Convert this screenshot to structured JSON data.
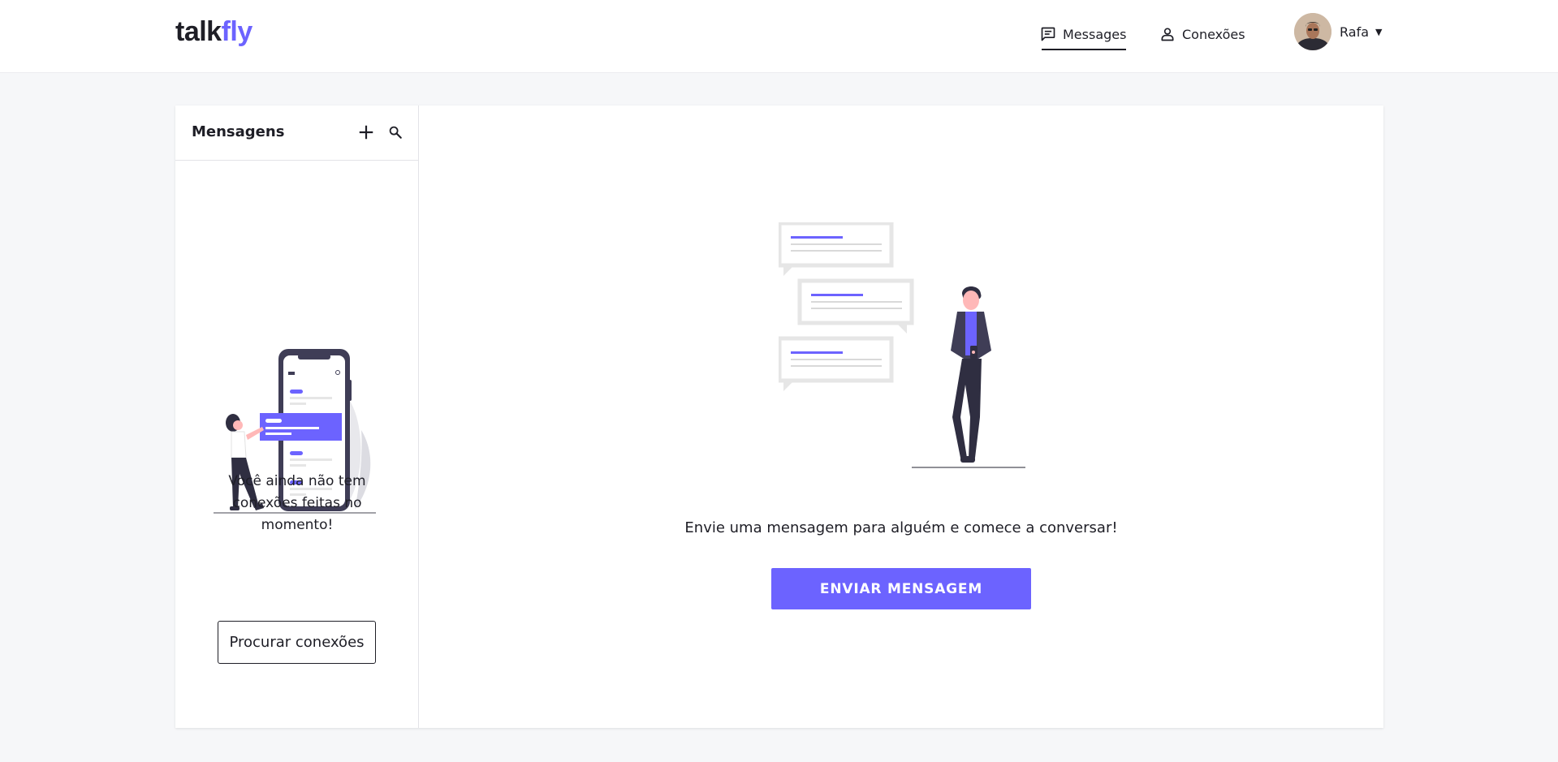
{
  "brand": {
    "name_part1": "talk",
    "name_part2": "fly",
    "accent_color": "#6c63ff"
  },
  "nav": {
    "items": [
      {
        "label": "Messages",
        "icon": "message-icon",
        "active": true
      },
      {
        "label": "Conexões",
        "icon": "person-icon",
        "active": false
      }
    ]
  },
  "user": {
    "name": "Rafa",
    "menu_icon": "caret-down-icon"
  },
  "sidebar": {
    "title": "Mensagens",
    "add_icon": "plus-icon",
    "search_icon": "search-icon",
    "empty_message": "Você ainda não tem conexões feitas no momento!",
    "find_button": "Procurar conexões"
  },
  "main": {
    "prompt": "Envie uma mensagem para alguém e comece a conversar!",
    "send_button": "ENVIAR MENSAGEM"
  }
}
